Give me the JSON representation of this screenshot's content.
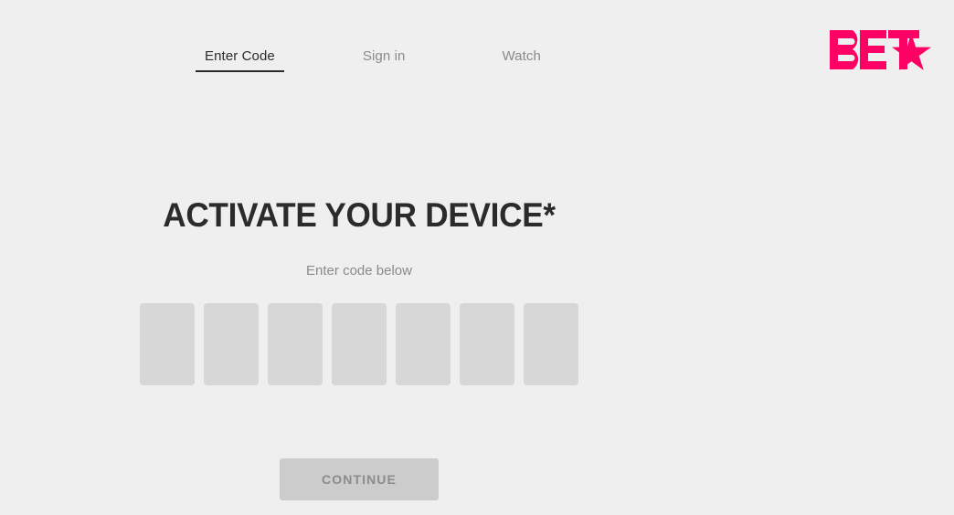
{
  "page": {
    "background_color": "#efefef"
  },
  "header": {
    "nav": [
      {
        "label": "Enter Code",
        "active": true
      },
      {
        "label": "Sign in",
        "active": false
      },
      {
        "label": "Watch",
        "active": false
      }
    ],
    "logo": {
      "name": "bet-logo",
      "wordmark": "BET",
      "symbol": "star",
      "color": "#ff0064"
    }
  },
  "main": {
    "title": "ACTIVATE YOUR DEVICE*",
    "subtitle": "Enter code below",
    "code_entry": {
      "length": 7,
      "placeholder": "",
      "values": [
        "",
        "",
        "",
        "",
        "",
        "",
        ""
      ],
      "box_color": "#d7d7d7"
    },
    "continue_button": {
      "label": "CONTINUE",
      "enabled": false,
      "background_color": "#cccccc",
      "text_color": "#8c8c8c"
    }
  }
}
